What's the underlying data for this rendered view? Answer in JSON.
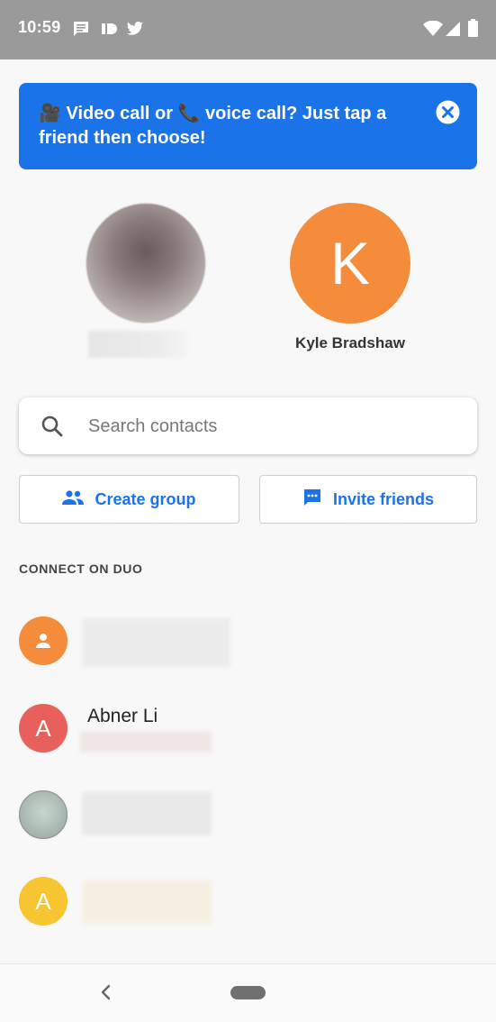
{
  "status_bar": {
    "time": "10:59",
    "left_icons": [
      "message-icon",
      "pocket-casts-icon",
      "twitter-icon"
    ],
    "right_icons": [
      "wifi-icon",
      "cell-signal-icon",
      "battery-icon"
    ]
  },
  "banner": {
    "text": "🎥 Video call or 📞 voice call? Just tap a friend then choose!",
    "close_icon": "close-circle-icon",
    "color": "#1a73e8"
  },
  "favorites": [
    {
      "name": "",
      "avatar": "photo"
    },
    {
      "name": "Kyle Bradshaw",
      "initial": "K",
      "color": "#f58c3b"
    }
  ],
  "search": {
    "placeholder": "Search contacts",
    "value": ""
  },
  "actions": {
    "create_group": "Create group",
    "invite_friends": "Invite friends"
  },
  "section": {
    "title": "CONNECT ON DUO"
  },
  "contacts": [
    {
      "name": "",
      "avatar": "person-icon",
      "color": "#f58c3b"
    },
    {
      "name": "Abner Li",
      "initial": "A",
      "color": "#e8605c"
    },
    {
      "name": "",
      "avatar": "photo"
    },
    {
      "name": "",
      "initial": "A",
      "color": "#f7c531"
    }
  ],
  "nav": {
    "back_icon": "back-chevron-icon",
    "home_icon": "home-pill-icon"
  }
}
